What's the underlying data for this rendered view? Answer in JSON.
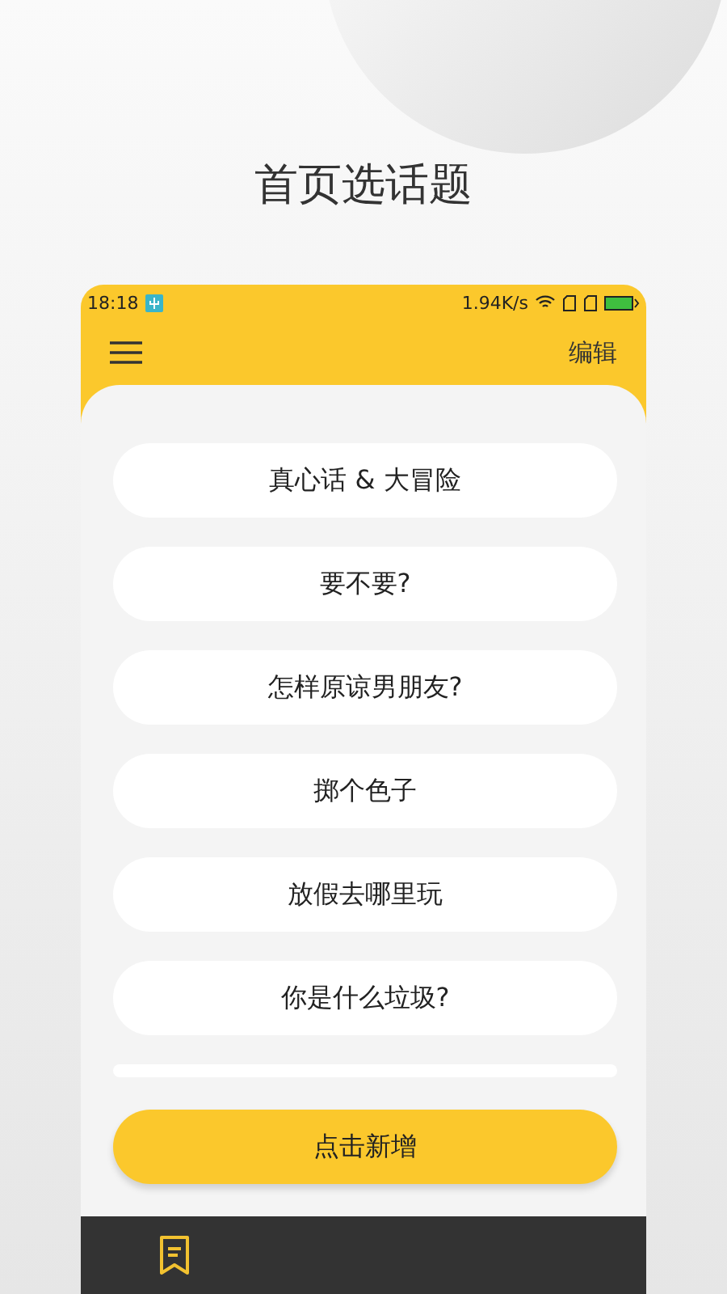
{
  "headline": "首页选话题",
  "status_bar": {
    "time": "18:18",
    "speed": "1.94K/s"
  },
  "app_bar": {
    "action": "编辑"
  },
  "topics": [
    "真心话 & 大冒险",
    "要不要?",
    "怎样原谅男朋友?",
    "掷个色子",
    "放假去哪里玩",
    "你是什么垃圾?"
  ],
  "add_button": "点击新增"
}
